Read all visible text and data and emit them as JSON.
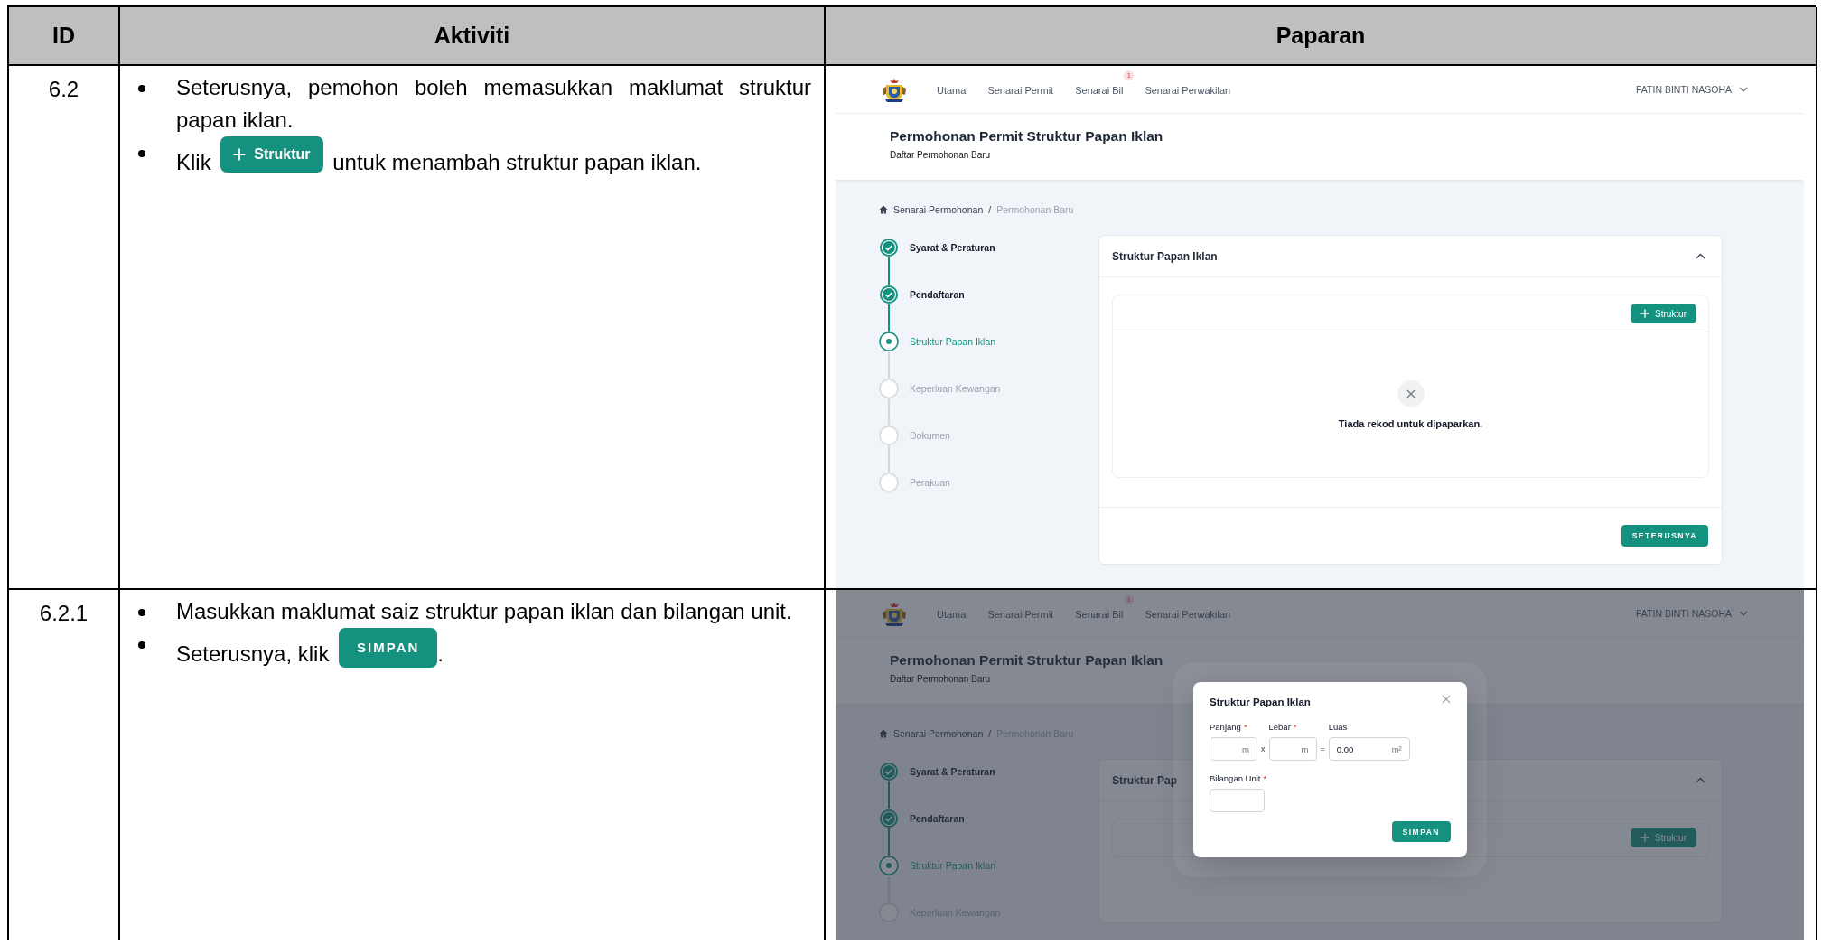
{
  "table": {
    "columns": [
      "ID",
      "Aktiviti",
      "Paparan"
    ],
    "rows": [
      {
        "id": "6.2",
        "steps": [
          {
            "parts": [
              {
                "kind": "text",
                "text": "Seterusnya, pemohon boleh memasukkan maklumat struktur papan iklan."
              }
            ]
          },
          {
            "parts": [
              {
                "kind": "text",
                "text": "Klik"
              },
              {
                "kind": "add-button",
                "text": "Struktur"
              },
              {
                "kind": "text",
                "text": "untuk menambah struktur papan iklan."
              }
            ]
          }
        ],
        "screen": {
          "nav": {
            "items": [
              {
                "label": "Utama"
              },
              {
                "label": "Senarai Permit"
              },
              {
                "label": "Senarai Bil",
                "badge": "1"
              },
              {
                "label": "Senarai Perwakilan"
              }
            ],
            "user": "FATIN BINTI NASOHA"
          },
          "title": "Permohonan Permit Struktur Papan Iklan",
          "subtitle": "Daftar Permohonan Baru",
          "breadcrumb": {
            "items": [
              "Senarai Permohonan",
              "Permohonan Baru"
            ],
            "separator": "/"
          },
          "steps": [
            {
              "label": "Syarat & Peraturan",
              "completed": true,
              "selected": false
            },
            {
              "label": "Pendaftaran",
              "completed": true,
              "selected": false
            },
            {
              "label": "Struktur Papan Iklan",
              "completed": false,
              "selected": true
            },
            {
              "label": "Keperluan Kewangan",
              "completed": false,
              "selected": false
            },
            {
              "label": "Dokumen",
              "completed": false,
              "selected": false
            },
            {
              "label": "Perakuan",
              "completed": false,
              "selected": false
            }
          ],
          "card": {
            "title": "Struktur Papan Iklan",
            "expanded": true,
            "add_button": "Struktur",
            "empty_message": "Tiada rekod untuk dipaparkan.",
            "next_button": "SETERUSNYA"
          }
        }
      },
      {
        "id": "6.2.1",
        "steps": [
          {
            "parts": [
              {
                "kind": "text",
                "text": "Masukkan maklumat saiz struktur papan iklan dan bilangan unit."
              }
            ]
          },
          {
            "parts": [
              {
                "kind": "text",
                "text": "Seterusnya, klik"
              },
              {
                "kind": "action-button",
                "text": "SIMPAN"
              },
              {
                "kind": "tail",
                "text": "."
              }
            ]
          }
        ],
        "screen": {
          "nav": {
            "items": [
              {
                "label": "Utama"
              },
              {
                "label": "Senarai Permit"
              },
              {
                "label": "Senarai Bil",
                "badge": "1"
              },
              {
                "label": "Senarai Perwakilan"
              }
            ],
            "user": "FATIN BINTI NASOHA"
          },
          "title": "Permohonan Permit Struktur Papan Iklan",
          "subtitle": "Daftar Permohonan Baru",
          "breadcrumb": {
            "items": [
              "Senarai Permohonan",
              "Permohonan Baru"
            ],
            "separator": "/"
          },
          "steps": [
            {
              "label": "Syarat & Peraturan",
              "completed": true,
              "selected": false
            },
            {
              "label": "Pendaftaran",
              "completed": true,
              "selected": false
            },
            {
              "label": "Struktur Papan Iklan",
              "completed": false,
              "selected": true
            },
            {
              "label": "Keperluan Kewangan",
              "completed": false,
              "selected": false
            }
          ],
          "card": {
            "title": "Struktur Pap",
            "expanded": true,
            "add_button": "Struktur"
          },
          "modal": {
            "title": "Struktur Papan Iklan",
            "required_mark": "*",
            "size_row": [
              {
                "kind": "field",
                "label": "Panjang",
                "required": true,
                "unit": "m"
              },
              {
                "kind": "operator",
                "text": "x"
              },
              {
                "kind": "field",
                "label": "Lebar",
                "required": true,
                "unit": "m"
              },
              {
                "kind": "operator",
                "text": "="
              },
              {
                "kind": "field",
                "label": "Luas",
                "required": false,
                "value": "0.00",
                "unit": "m²"
              }
            ],
            "unit_field": {
              "label": "Bilangan Unit",
              "required": true
            },
            "save_button": "SIMPAN"
          }
        }
      }
    ]
  }
}
